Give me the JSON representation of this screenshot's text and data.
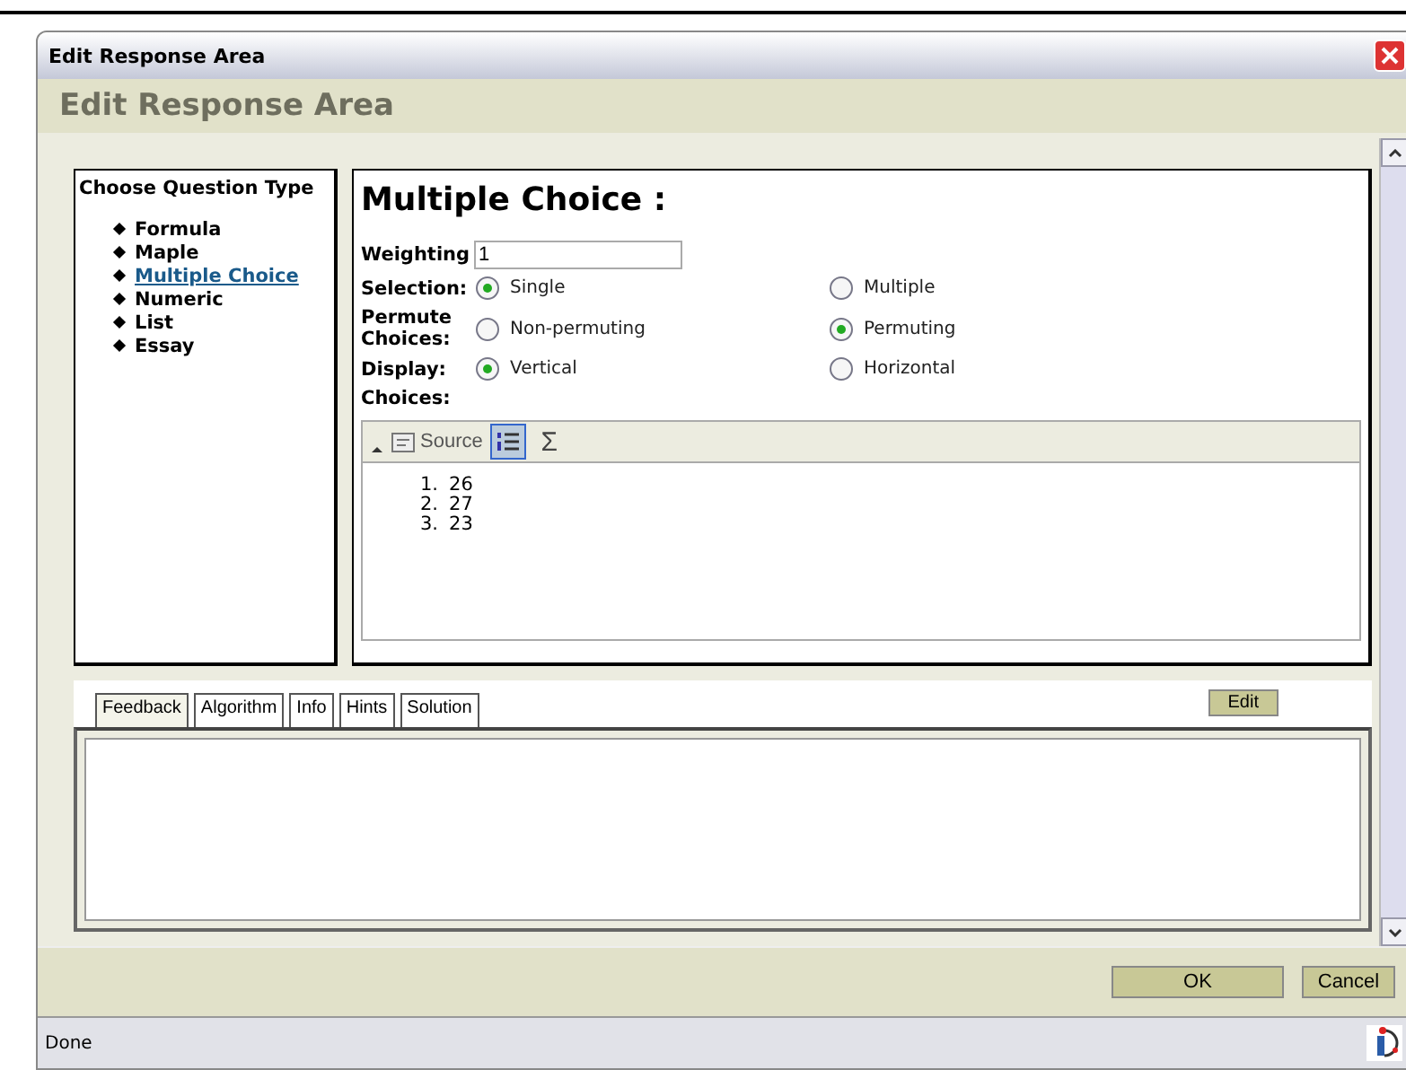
{
  "window": {
    "title": "Edit Response Area"
  },
  "header": {
    "title": "Edit Response Area"
  },
  "question_types": {
    "title": "Choose Question Type",
    "items": [
      {
        "label": "Formula",
        "selected": false
      },
      {
        "label": "Maple",
        "selected": false
      },
      {
        "label": "Multiple Choice",
        "selected": true
      },
      {
        "label": "Numeric",
        "selected": false
      },
      {
        "label": "List",
        "selected": false
      },
      {
        "label": "Essay",
        "selected": false
      }
    ]
  },
  "editor": {
    "title": "Multiple Choice :",
    "weighting": {
      "label": "Weighting",
      "value": "1"
    },
    "option_groups": [
      {
        "label": "Selection:",
        "options": [
          {
            "label": "Single",
            "selected": true
          },
          {
            "label": "Multiple",
            "selected": false
          }
        ]
      },
      {
        "label": "Permute Choices:",
        "options": [
          {
            "label": "Non-permuting",
            "selected": false
          },
          {
            "label": "Permuting",
            "selected": true
          }
        ]
      },
      {
        "label": "Display:",
        "options": [
          {
            "label": "Vertical",
            "selected": true
          },
          {
            "label": "Horizontal",
            "selected": false
          }
        ]
      }
    ],
    "choices_label": "Choices:",
    "toolbar": {
      "source_label": "Source",
      "numbered_list_on": true,
      "sigma": "Σ"
    },
    "choices": [
      {
        "number": "1.",
        "text": "26"
      },
      {
        "number": "2.",
        "text": "27"
      },
      {
        "number": "3.",
        "text": "23"
      }
    ]
  },
  "tabs": [
    {
      "label": "Feedback",
      "selected": true
    },
    {
      "label": "Algorithm",
      "selected": false
    },
    {
      "label": "Info",
      "selected": false
    },
    {
      "label": "Hints",
      "selected": false
    },
    {
      "label": "Solution",
      "selected": false
    }
  ],
  "edit_button": "Edit",
  "buttons": [
    "OK",
    "Cancel"
  ],
  "status_bar": {
    "text": "Done"
  }
}
